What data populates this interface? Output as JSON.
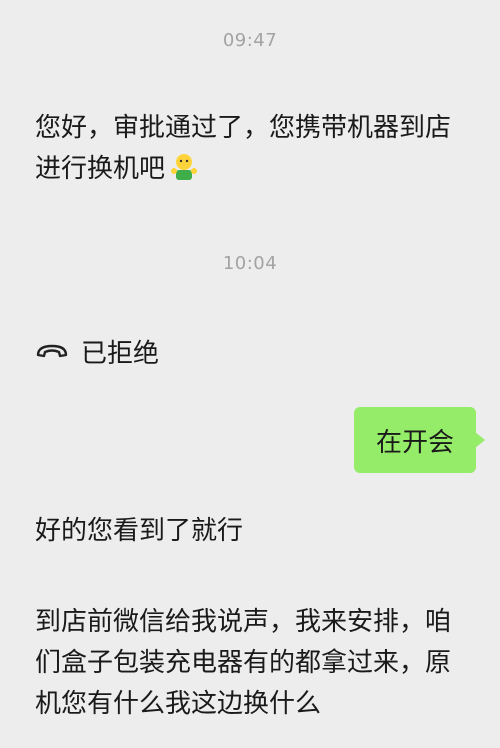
{
  "chat": {
    "time1": "09:47",
    "msg1": "您好，审批通过了，您携带机器到店进行换机吧",
    "time2": "10:04",
    "call_status": "已拒绝",
    "reply": "在开会",
    "msg2": "好的您看到了就行",
    "msg3": "到店前微信给我说声，我来安排，咱们盒子包装充电器有的都拿过来，原机您有什么我这边换什么"
  },
  "icons": {
    "emoji": "ok-gesture-emoji",
    "call": "phone-hangup-icon"
  },
  "colors": {
    "background": "#ededed",
    "outgoing_bubble": "#95ec69",
    "timestamp": "#a3a3a3"
  }
}
